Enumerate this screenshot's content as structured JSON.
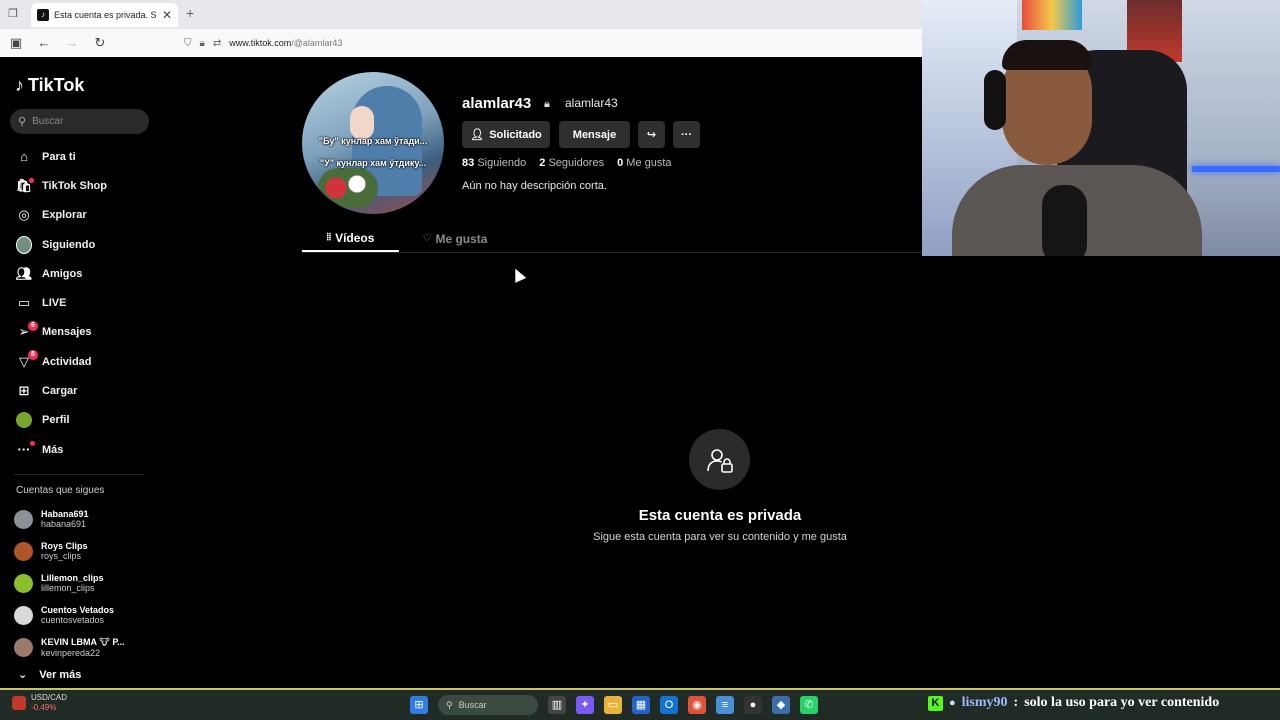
{
  "browser": {
    "tab_title": "Esta cuenta es privada. Sigue e:",
    "url_prefix": "www.tiktok.com",
    "url_path": "/@alamlar43"
  },
  "sidebar": {
    "logo": "TikTok",
    "search_placeholder": "Buscar",
    "items": [
      {
        "label": "Para ti",
        "icon": "home-icon"
      },
      {
        "label": "TikTok Shop",
        "icon": "shop-icon"
      },
      {
        "label": "Explorar",
        "icon": "compass-icon"
      },
      {
        "label": "Siguiendo",
        "icon": "following-avatar-icon"
      },
      {
        "label": "Amigos",
        "icon": "friends-icon"
      },
      {
        "label": "LIVE",
        "icon": "live-icon"
      },
      {
        "label": "Mensajes",
        "icon": "messages-icon",
        "badge": "6"
      },
      {
        "label": "Actividad",
        "icon": "activity-icon",
        "badge": "8"
      },
      {
        "label": "Cargar",
        "icon": "upload-icon"
      },
      {
        "label": "Perfil",
        "icon": "profile-avatar-icon"
      },
      {
        "label": "Más",
        "icon": "more-icon"
      }
    ],
    "following_title": "Cuentas que sigues",
    "following": [
      {
        "name": "Habana691",
        "handle": "habana691",
        "color": "#8a8f98"
      },
      {
        "name": "Roys Clips",
        "handle": "roys_clips",
        "color": "#b0552a"
      },
      {
        "name": "Lillemon_clips",
        "handle": "lillemon_clips",
        "color": "#8bbd2c"
      },
      {
        "name": "Cuentos Vetados",
        "handle": "cuentosvetados",
        "color": "#d9d9d9"
      },
      {
        "name": "KEVIN LBMA 🐮 P...",
        "handle": "kevinpereda22",
        "color": "#9a7a6a"
      }
    ],
    "see_more": "Ver más"
  },
  "profile": {
    "avatar_caption_1": "\"Бу\" кунлар хам ўтади...",
    "avatar_caption_2": "\"У\" кунлар хам ўтдику...",
    "username": "alamlar43",
    "nickname": "alamlar43",
    "requested_label": "Solicitado",
    "message_label": "Mensaje",
    "stats": {
      "following_count": "83",
      "following_label": "Siguiendo",
      "followers_count": "2",
      "followers_label": "Seguidores",
      "likes_count": "0",
      "likes_label": "Me gusta"
    },
    "bio": "Aún no hay descripción corta.",
    "tabs": {
      "videos": "Vídeos",
      "likes": "Me gusta"
    },
    "private_title": "Esta cuenta es privada",
    "private_subtitle": "Sigue esta cuenta para ver su contenido y me gusta"
  },
  "taskbar": {
    "stock_pair": "USD/CAD",
    "stock_change": "-0.49%",
    "search_label": "Buscar"
  },
  "chat": {
    "user": "lismy90",
    "separator": ":",
    "message": "solo la uso para yo ver contenido"
  },
  "colors": {
    "accent": "#fe2c55",
    "background": "#000000",
    "button_bg": "#2f2f2f"
  }
}
